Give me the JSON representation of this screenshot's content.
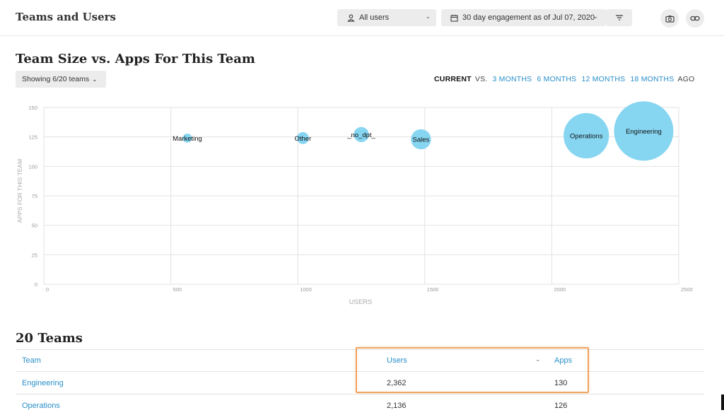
{
  "header": {
    "title": "Teams and Users",
    "user_filter": "All users",
    "date_filter": "30 day engagement as of Jul 07, 2020"
  },
  "chart_section": {
    "title": "Team Size vs. Apps For This Team",
    "teams_dropdown": "Showing 6/20 teams",
    "compare": {
      "current": "CURRENT",
      "vs": "VS.",
      "options": [
        "3 MONTHS",
        "6 MONTHS",
        "12 MONTHS",
        "18 MONTHS"
      ],
      "suffix": "AGO"
    }
  },
  "chart_data": {
    "type": "scatter",
    "xlabel": "USERS",
    "ylabel": "APPS FOR THIS TEAM",
    "xlim": [
      0,
      2500
    ],
    "ylim": [
      0,
      150
    ],
    "x_ticks": [
      0,
      500,
      1000,
      1500,
      2000,
      2500
    ],
    "y_ticks": [
      0,
      25,
      50,
      75,
      100,
      125,
      150
    ],
    "grid": true,
    "bubble_color": "#7fd3f0",
    "points": [
      {
        "label": "Marketing",
        "x": 565,
        "y": 124
      },
      {
        "label": "Other",
        "x": 1020,
        "y": 124
      },
      {
        "label": "_no_dpt_",
        "x": 1250,
        "y": 127
      },
      {
        "label": "Sales",
        "x": 1485,
        "y": 123
      },
      {
        "label": "Operations",
        "x": 2136,
        "y": 126
      },
      {
        "label": "Engineering",
        "x": 2362,
        "y": 130
      }
    ]
  },
  "table": {
    "title": "20 Teams",
    "columns": [
      "Team",
      "Users",
      "Apps"
    ],
    "rows": [
      [
        "Engineering",
        "2,362",
        "130"
      ],
      [
        "Operations",
        "2,136",
        "126"
      ]
    ]
  },
  "colors": {
    "link": "#2a8fc9",
    "bubble": "#7fd3f0",
    "highlight": "#f0a35e"
  }
}
